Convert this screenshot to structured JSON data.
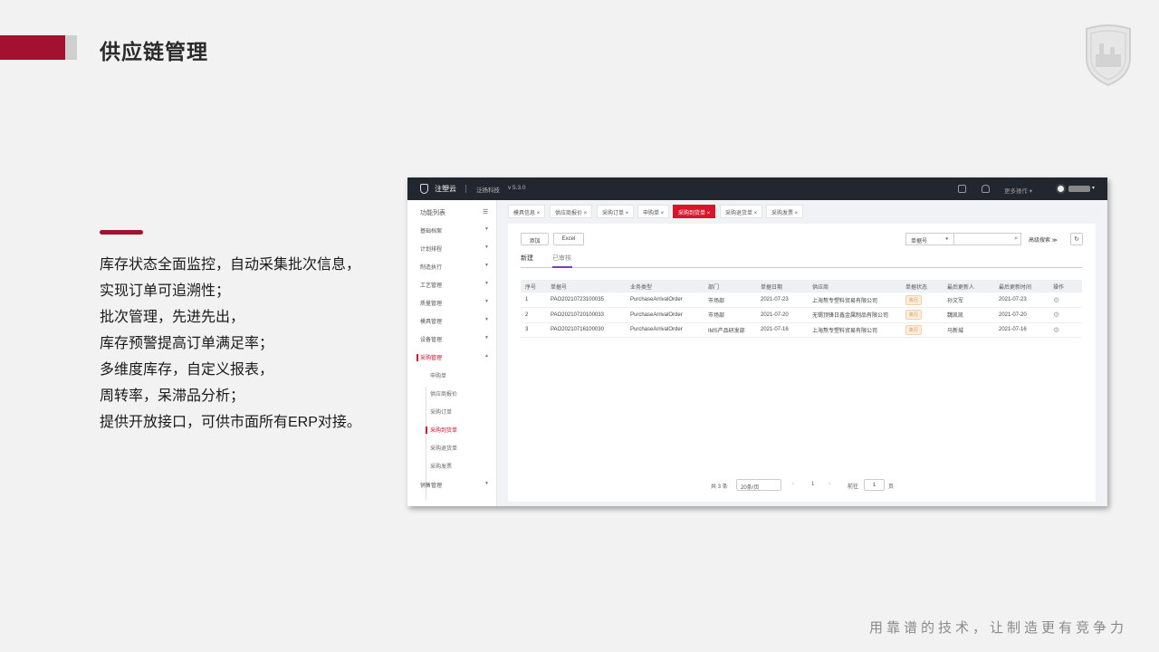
{
  "slide": {
    "title": "供应链管理",
    "features": [
      "库存状态全面监控，自动采集批次信息，",
      "实现订单可追溯性；",
      "批次管理，先进先出，",
      "库存预警提高订单满足率；",
      "多维度库存，自定义报表，",
      "周转率，呆滞品分析；",
      "提供开放接口，可供市面所有ERP对接。"
    ],
    "tagline": "用靠谱的技术，让制造更有竞争力"
  },
  "app": {
    "brand": "注塑云",
    "company": "泛扬科技",
    "version": "v 5.3.0",
    "more_ops": "更多操作 ▾",
    "sidebar": {
      "header": "功能列表",
      "header_icon": "☰",
      "items": [
        {
          "label": "基础档案"
        },
        {
          "label": "计划排程"
        },
        {
          "label": "制造执行"
        },
        {
          "label": "工艺管理"
        },
        {
          "label": "质量管理"
        },
        {
          "label": "模具管理"
        },
        {
          "label": "设备管理"
        },
        {
          "label": "采购管理"
        },
        {
          "label": "销售管理"
        }
      ],
      "subitems": [
        {
          "label": "申购单"
        },
        {
          "label": "供应商报价"
        },
        {
          "label": "采购订单"
        },
        {
          "label": "采购到货单"
        },
        {
          "label": "采购退货单"
        },
        {
          "label": "采购发票"
        }
      ]
    },
    "tabs": [
      {
        "label": "模具信息 ×"
      },
      {
        "label": "供应商报价 ×"
      },
      {
        "label": "采购订单 ×"
      },
      {
        "label": "申购单 ×"
      },
      {
        "label": "采购到货单 ×"
      },
      {
        "label": "采购退货单 ×"
      },
      {
        "label": "采购发票 ×"
      }
    ],
    "toolbar": {
      "add": "添加",
      "excel": "Excel",
      "search_field": "单据号",
      "advanced": "高级搜索 ≫",
      "refresh": "↻"
    },
    "subtabs": [
      "新建",
      "已审核"
    ],
    "table": {
      "headers": [
        "序号",
        "单据号",
        "业务类型",
        "部门",
        "单据日期",
        "供应商",
        "单据状态",
        "最后更新人",
        "最后更新时间",
        "操作"
      ],
      "rows": [
        [
          "1",
          "PAO20210723100035",
          "PurchaseArrivalOrder",
          "市场部",
          "2021-07-23",
          "上海熬专塑料贸易有限公司",
          "执行",
          "孙文军",
          "2021-07-23",
          "⚙"
        ],
        [
          "2",
          "PAO20210720100033",
          "PurchaseArrivalOrder",
          "市场部",
          "2021-07-20",
          "无锡顶锋日鑫金属制品有限公司",
          "执行",
          "魏凯凯",
          "2021-07-20",
          "⚙"
        ],
        [
          "3",
          "PAO20210716100030",
          "PurchaseArrivalOrder",
          "IMS产品研发部",
          "2021-07-16",
          "上海熬专塑料贸易有限公司",
          "执行",
          "马新城",
          "2021-07-16",
          "⚙"
        ]
      ]
    },
    "pager": {
      "total": "共 3 条",
      "page_size": "20条/页",
      "prev": "‹",
      "current": "1",
      "next": "›",
      "goto": "前往",
      "goto_value": "1",
      "page_unit": "页"
    }
  }
}
